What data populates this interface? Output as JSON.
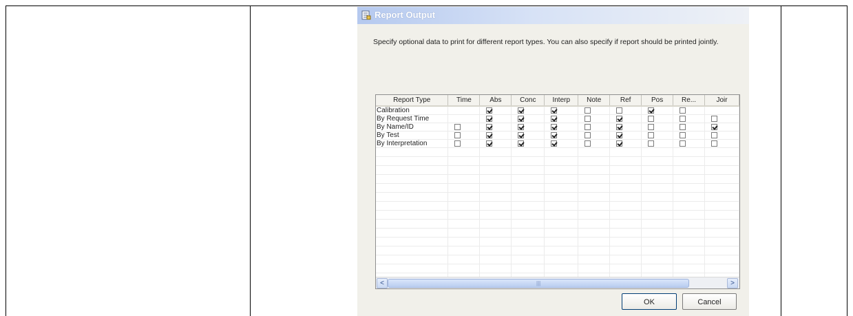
{
  "dialog": {
    "title": "Report Output",
    "description": "Specify optional data to print for different report types.  You can also specify if report should be printed jointly.",
    "columns": [
      "Report Type",
      "Time",
      "Abs",
      "Conc",
      "Interp",
      "Note",
      "Ref",
      "Pos",
      "Re...",
      "Joir"
    ],
    "rows": [
      {
        "label": "Calibration",
        "checks": [
          null,
          true,
          true,
          true,
          false,
          false,
          true,
          false,
          null
        ]
      },
      {
        "label": "By Request Time",
        "checks": [
          null,
          true,
          true,
          true,
          false,
          true,
          false,
          false,
          false
        ]
      },
      {
        "label": "By Name/ID",
        "checks": [
          false,
          true,
          true,
          true,
          false,
          true,
          false,
          false,
          true
        ]
      },
      {
        "label": "By Test",
        "checks": [
          false,
          true,
          true,
          true,
          false,
          true,
          false,
          false,
          false
        ]
      },
      {
        "label": "By Interpretation",
        "checks": [
          false,
          true,
          true,
          true,
          false,
          true,
          false,
          false,
          false
        ]
      }
    ],
    "ok_label": "OK",
    "cancel_label": "Cancel",
    "scroll_left": "<",
    "scroll_right": ">"
  }
}
